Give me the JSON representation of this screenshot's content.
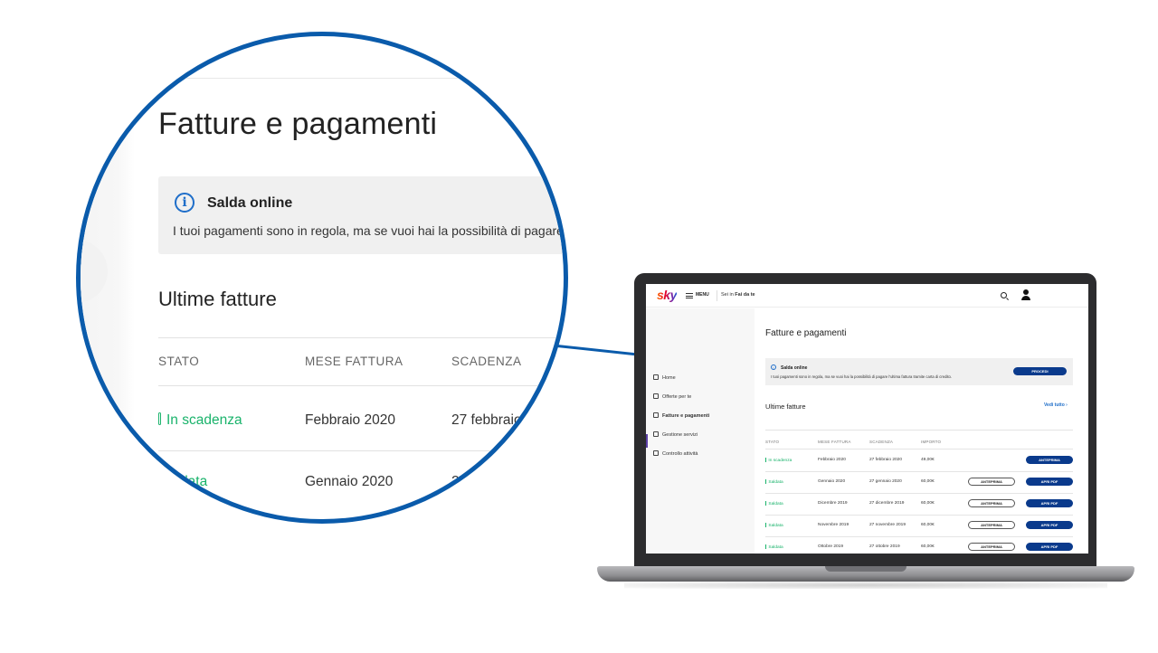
{
  "page": {
    "title": "Fatture e pagamenti",
    "banner": {
      "title": "Salda online",
      "text": "I tuoi pagamenti sono in regola, ma se vuoi hai la possibilità di pagare l'ultima fattura tramite carta di credito.",
      "text_mag": "I tuoi pagamenti sono in regola, ma se vuoi hai la possibilità di pagare l'u",
      "button": "PROCEDI"
    },
    "section": "Ultime fatture",
    "see_all": "Vedi tutto",
    "see_all_arrow": "›",
    "columns": [
      "STATO",
      "MESE FATTURA",
      "SCADENZA",
      "IMPORTO"
    ],
    "rows": [
      {
        "status": "In scadenza",
        "month": "Febbraio 2020",
        "due": "27 febbraio 2020",
        "amount": "49,00€",
        "preview": "",
        "pdf": "ANTEPRIMA"
      },
      {
        "status": "Saldata",
        "month": "Gennaio 2020",
        "due": "27 gennaio 2020",
        "amount": "60,00€",
        "preview": "ANTEPRIMA",
        "pdf": "APRI PDF"
      },
      {
        "status": "Saldata",
        "month": "Dicembre 2019",
        "due": "27 dicembre 2019",
        "amount": "60,00€",
        "preview": "ANTEPRIMA",
        "pdf": "APRI PDF"
      },
      {
        "status": "Saldata",
        "month": "Novembre 2019",
        "due": "27 novembre 2019",
        "amount": "60,00€",
        "preview": "ANTEPRIMA",
        "pdf": "APRI PDF"
      },
      {
        "status": "Saldata",
        "month": "Ottobre 2019",
        "due": "27 ottobre 2019",
        "amount": "60,00€",
        "preview": "ANTEPRIMA",
        "pdf": "APRI PDF"
      }
    ],
    "mag_rows": [
      {
        "status": "In scadenza",
        "month": "Febbraio 2020",
        "due": "27 febbraio"
      },
      {
        "status": "aldata",
        "month": "Gennaio 2020",
        "due": "27"
      }
    ]
  },
  "header": {
    "logo": "sky",
    "menu_label": "MENU",
    "crumb_prefix": "Sei in",
    "crumb_current": "Fai da te"
  },
  "sidebar": {
    "items": [
      {
        "label": "Home"
      },
      {
        "label": "Offerte per te"
      },
      {
        "label": "Fatture e pagamenti"
      },
      {
        "label": "Gestione servizi"
      },
      {
        "label": "Controllo attività"
      }
    ]
  },
  "colors": {
    "accent": "#0a5bab",
    "status_green": "#19b36b",
    "button_dark": "#0a3a8c",
    "link_blue": "#1f6ec9"
  },
  "icons": {
    "info": "i"
  }
}
